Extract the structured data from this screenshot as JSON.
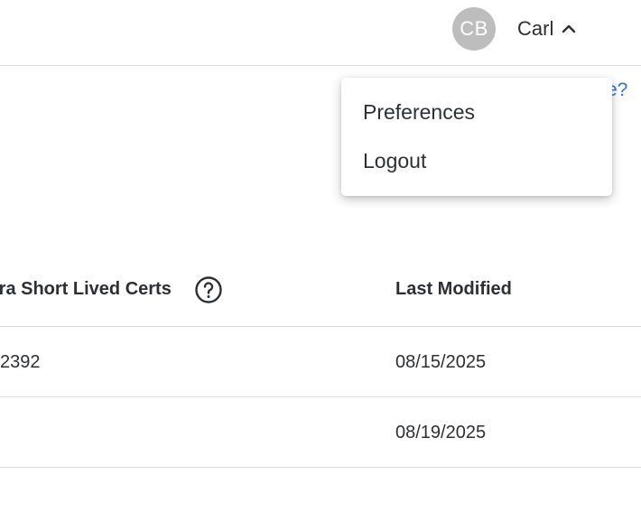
{
  "header": {
    "avatar_initials": "CB",
    "user_name": "Carl",
    "menu_state_icon": "chevron-up-icon"
  },
  "background_link": {
    "visible_text": "e?",
    "color": "#2f6fd6"
  },
  "dropdown": {
    "items": [
      {
        "label": "Preferences"
      },
      {
        "label": "Logout"
      }
    ]
  },
  "table": {
    "columns": [
      {
        "label": "tra Short Lived Certs",
        "icon": "help-circle-icon"
      },
      {
        "label": "Last Modified"
      }
    ],
    "rows": [
      {
        "cells": [
          "2392",
          "08/15/2025"
        ]
      },
      {
        "cells": [
          "",
          "08/19/2025"
        ]
      }
    ]
  },
  "colors": {
    "avatar_bg": "#bdbdbd",
    "text": "#2d2f33",
    "divider": "#d9dadd",
    "link": "#2f6fd6"
  }
}
